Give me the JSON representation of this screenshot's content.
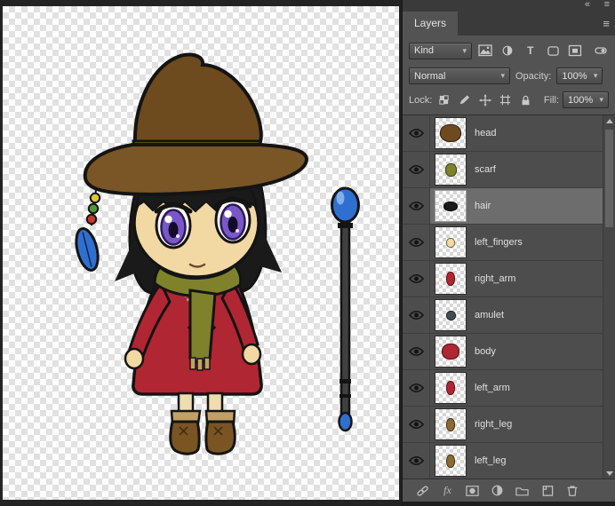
{
  "window": {
    "collapse_glyph": "«",
    "menu_glyph": "≡"
  },
  "panel": {
    "tab_label": "Layers",
    "menu_glyph": "≡",
    "chevron_glyph": "▾",
    "filter": {
      "kind_label": "Kind",
      "type_glyph": "T"
    },
    "blend": {
      "mode": "Normal",
      "opacity_label": "Opacity:",
      "opacity_value": "100%"
    },
    "lock": {
      "label": "Lock:",
      "fill_label": "Fill:",
      "fill_value": "100%"
    },
    "footer": {
      "fx_label": "fx"
    },
    "layers": [
      {
        "name": "head",
        "selected": false,
        "thumb_color": "#6e4a1f",
        "thumb_w": 22,
        "thumb_h": 18
      },
      {
        "name": "scarf",
        "selected": false,
        "thumb_color": "#7f822b",
        "thumb_w": 11,
        "thumb_h": 13
      },
      {
        "name": "hair",
        "selected": true,
        "thumb_color": "#1a1a1a",
        "thumb_w": 14,
        "thumb_h": 9
      },
      {
        "name": "left_fingers",
        "selected": false,
        "thumb_color": "#f2d8a2",
        "thumb_w": 8,
        "thumb_h": 9
      },
      {
        "name": "right_arm",
        "selected": false,
        "thumb_color": "#b02633",
        "thumb_w": 8,
        "thumb_h": 14
      },
      {
        "name": "amulet",
        "selected": false,
        "thumb_color": "#454b52",
        "thumb_w": 9,
        "thumb_h": 9
      },
      {
        "name": "body",
        "selected": false,
        "thumb_color": "#b02633",
        "thumb_w": 18,
        "thumb_h": 16
      },
      {
        "name": "left_arm",
        "selected": false,
        "thumb_color": "#b02633",
        "thumb_w": 8,
        "thumb_h": 14
      },
      {
        "name": "right_leg",
        "selected": false,
        "thumb_color": "#8a6a33",
        "thumb_w": 8,
        "thumb_h": 13
      },
      {
        "name": "left_leg",
        "selected": false,
        "thumb_color": "#8a6a33",
        "thumb_w": 8,
        "thumb_h": 13
      }
    ]
  },
  "canvas": {
    "character_colors": {
      "hat": "#6e4a1f",
      "hat_brim": "#7a5526",
      "hat_band": "#8a8d2b",
      "hair": "#1a1a1a",
      "skin": "#f2d8a2",
      "eye_white": "#ffffff",
      "iris": "#7a57c9",
      "pupil": "#140b28",
      "scarf": "#7f822b",
      "dress": "#b02633",
      "sock": "#efdcb0",
      "boots": "#7a5423",
      "boot_cuff": "#c2a065",
      "orb": "#2f6fd0",
      "orb_light": "#7fb0e8",
      "staff": "#404040",
      "pendant": "#454b52",
      "bead_yellow": "#e0c52e",
      "bead_green": "#4a9a3c",
      "bead_red": "#c03a2e"
    }
  }
}
